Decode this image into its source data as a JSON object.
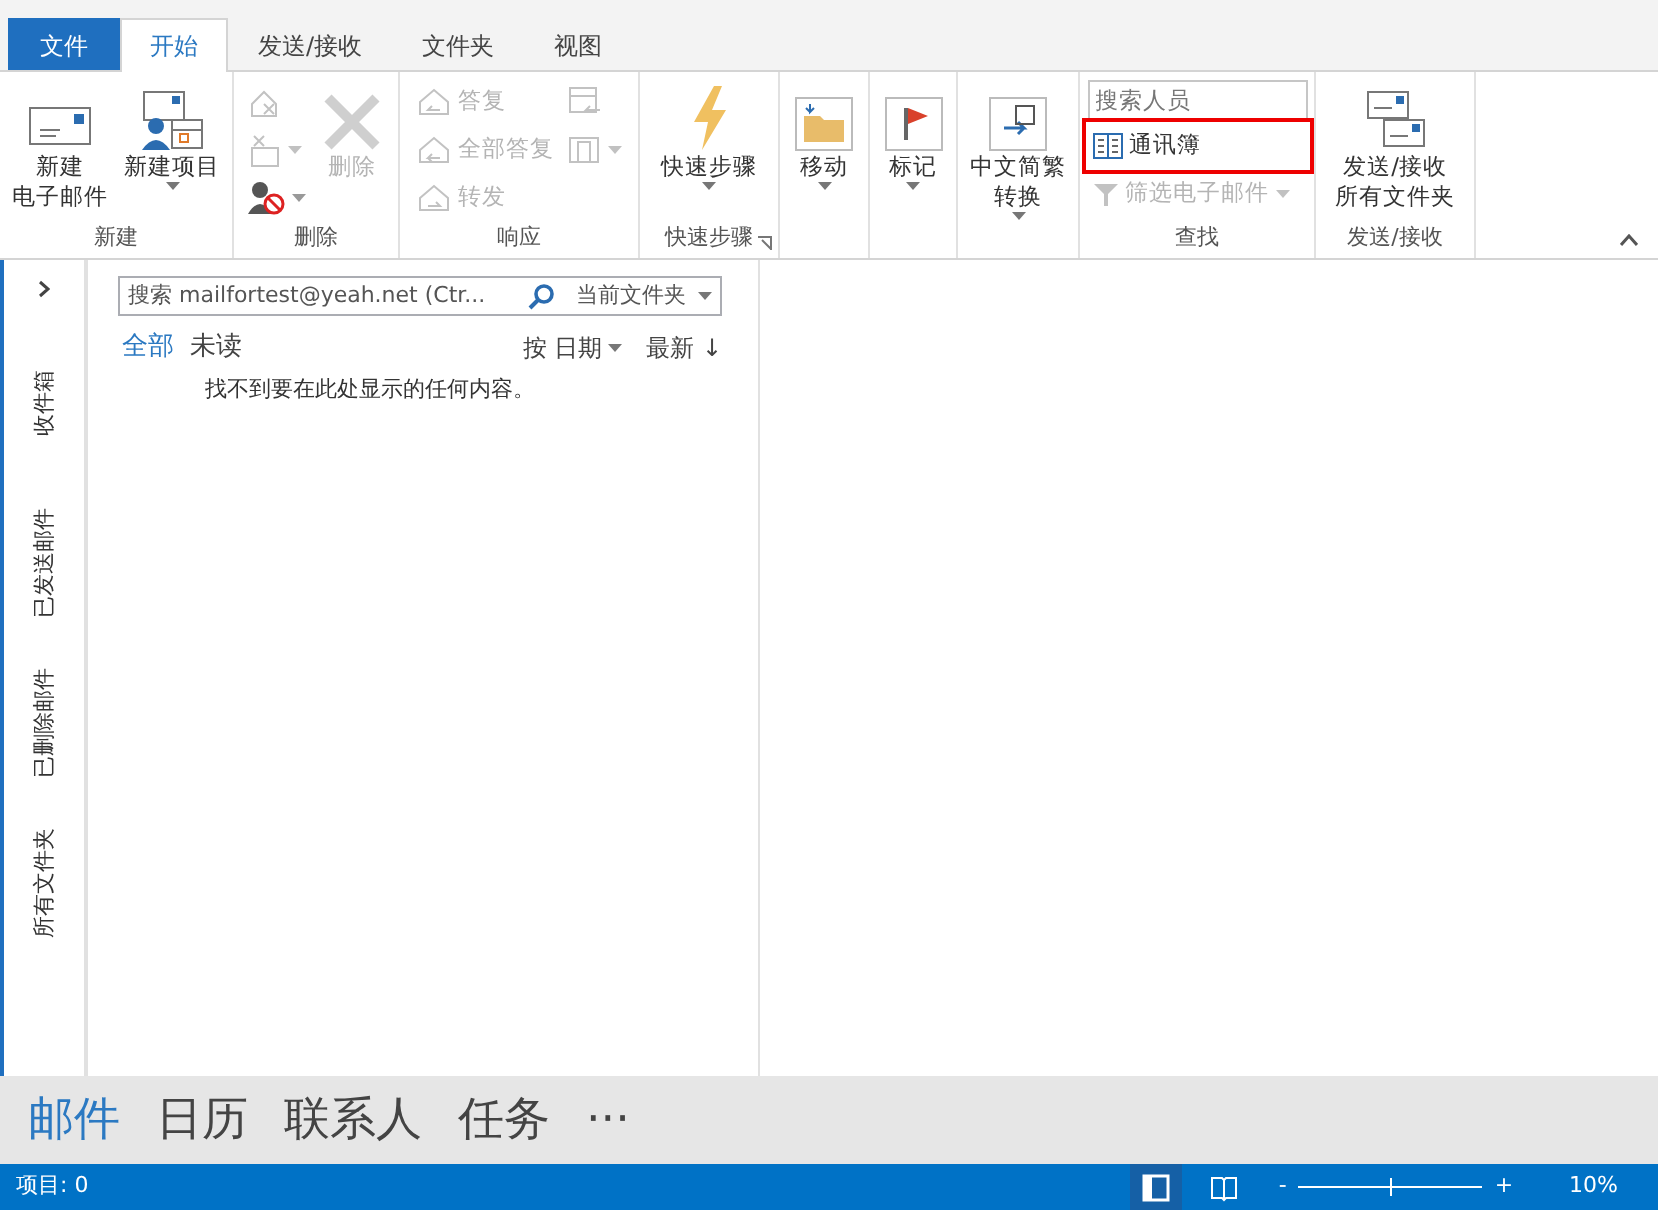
{
  "tabs": [
    {
      "label": "文件",
      "kind": "file",
      "selected": false
    },
    {
      "label": "开始",
      "kind": "tab",
      "selected": true
    },
    {
      "label": "发送/接收",
      "kind": "tab",
      "selected": false
    },
    {
      "label": "文件夹",
      "kind": "tab",
      "selected": false
    },
    {
      "label": "视图",
      "kind": "tab",
      "selected": false
    }
  ],
  "ribbon": {
    "groups": [
      {
        "label": "新建",
        "items": [
          {
            "kind": "large",
            "lines": [
              "新建",
              "电子邮件"
            ],
            "disabled": false,
            "dropdown": false
          },
          {
            "kind": "large",
            "lines": [
              "新建项目"
            ],
            "disabled": false,
            "dropdown": true
          }
        ]
      },
      {
        "label": "删除",
        "items": [
          {
            "kind": "icon",
            "disabled": true,
            "dropdown": false
          },
          {
            "kind": "icon",
            "disabled": true,
            "dropdown": true
          },
          {
            "kind": "icon",
            "disabled": false,
            "dropdown": true
          },
          {
            "kind": "large",
            "lines": [
              "删除"
            ],
            "disabled": true,
            "dropdown": false
          }
        ]
      },
      {
        "label": "响应",
        "items": [
          {
            "kind": "small",
            "label": "答复",
            "disabled": true,
            "dropdown": false
          },
          {
            "kind": "small",
            "label": "全部答复",
            "disabled": true,
            "dropdown": false
          },
          {
            "kind": "small",
            "label": "转发",
            "disabled": true,
            "dropdown": false
          },
          {
            "kind": "icon",
            "disabled": true,
            "dropdown": false
          },
          {
            "kind": "icon",
            "disabled": true,
            "dropdown": true
          }
        ]
      },
      {
        "label": "快速步骤",
        "launcher": true,
        "items": [
          {
            "kind": "large",
            "lines": [
              "快速步骤"
            ],
            "disabled": false,
            "dropdown": true
          }
        ]
      },
      {
        "items": [
          {
            "kind": "large",
            "lines": [
              "移动"
            ],
            "disabled": false,
            "dropdown": true
          }
        ]
      },
      {
        "items": [
          {
            "kind": "large",
            "lines": [
              "标记"
            ],
            "disabled": false,
            "dropdown": true
          }
        ]
      },
      {
        "items": [
          {
            "kind": "large",
            "lines": [
              "中文简繁",
              "转换"
            ],
            "disabled": false,
            "dropdown": true
          }
        ]
      },
      {
        "label": "查找",
        "items": [
          {
            "kind": "search",
            "placeholder": "搜索人员"
          },
          {
            "kind": "small",
            "label": "通讯簿",
            "disabled": false,
            "dropdown": false,
            "highlighted": true
          },
          {
            "kind": "small",
            "label": "筛选电子邮件",
            "disabled": true,
            "dropdown": true,
            "highlighted": false
          }
        ]
      },
      {
        "label": "发送/接收",
        "items": [
          {
            "kind": "large",
            "lines": [
              "发送/接收",
              "所有文件夹"
            ],
            "disabled": false,
            "dropdown": false
          }
        ]
      }
    ]
  },
  "folders": [
    {
      "label": "收件箱"
    },
    {
      "label": "已发送邮件"
    },
    {
      "label": "已删除邮件"
    },
    {
      "label": "所有文件夹"
    }
  ],
  "message_list": {
    "search": {
      "placeholder": "搜索 mailfortest@yeah.net (Ctr...",
      "scope": "当前文件夹"
    },
    "filters": [
      {
        "label": "全部",
        "selected": true
      },
      {
        "label": "未读",
        "selected": false
      }
    ],
    "sort": "按 日期",
    "order": "最新 ↓",
    "empty_text": "找不到要在此处显示的任何内容。"
  },
  "bottom_nav": [
    {
      "label": "邮件",
      "selected": true
    },
    {
      "label": "日历",
      "selected": false
    },
    {
      "label": "联系人",
      "selected": false
    },
    {
      "label": "任务",
      "selected": false
    },
    {
      "label": "···",
      "selected": false
    }
  ],
  "status_bar": {
    "items": "项目: 0",
    "views": [
      {
        "selected": true
      },
      {
        "selected": false
      }
    ],
    "zoom": {
      "minus": "-",
      "plus": "+",
      "level": 0.5,
      "reading": "10%"
    }
  }
}
